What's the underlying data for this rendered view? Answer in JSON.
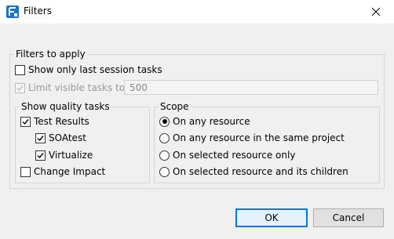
{
  "window": {
    "title": "Filters",
    "accent_color": "#0078d7"
  },
  "filters_group": {
    "label": "Filters to apply",
    "show_last_session": {
      "label": "Show only last session tasks",
      "checked": false
    },
    "limit_visible": {
      "label": "Limit visible tasks to:",
      "checked": true,
      "enabled": false
    },
    "limit_value": "500"
  },
  "quality_group": {
    "label": "Show quality tasks",
    "items": [
      {
        "label": "Test Results",
        "checked": true
      },
      {
        "label": "SOAtest",
        "checked": true
      },
      {
        "label": "Virtualize",
        "checked": true
      },
      {
        "label": "Change Impact",
        "checked": false
      }
    ]
  },
  "scope_group": {
    "label": "Scope",
    "options": [
      {
        "label": "On any resource",
        "selected": true
      },
      {
        "label": "On any resource in the same project",
        "selected": false
      },
      {
        "label": "On selected resource only",
        "selected": false
      },
      {
        "label": "On selected resource and its children",
        "selected": false
      }
    ]
  },
  "buttons": {
    "ok": "OK",
    "cancel": "Cancel"
  }
}
